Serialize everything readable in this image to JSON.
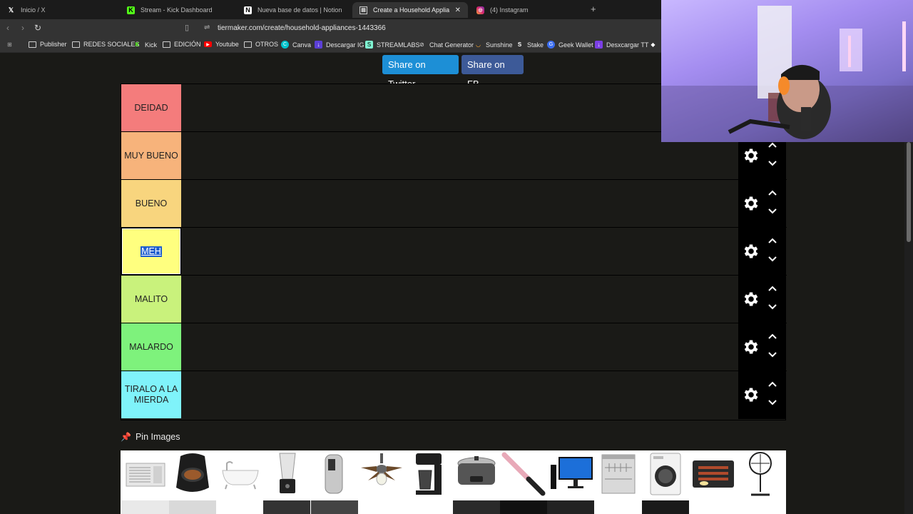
{
  "browser": {
    "tabs": [
      {
        "title": "Inicio / X",
        "icon": "x-logo-icon",
        "active": false
      },
      {
        "title": "Stream - Kick Dashboard",
        "icon": "kick-logo-icon",
        "active": false
      },
      {
        "title": "Nueva base de datos | Notion",
        "icon": "notion-logo-icon",
        "active": false
      },
      {
        "title": "Create a Household Appliances",
        "icon": "tiermaker-icon",
        "active": true
      },
      {
        "title": "(4) Instagram",
        "icon": "instagram-logo-icon",
        "active": false
      }
    ],
    "new_tab": "+",
    "url": "tiermaker.com/create/household-appliances-1443366",
    "bookmarks": [
      {
        "label": "Publisher",
        "icon": "folder-icon"
      },
      {
        "label": "REDES SOCIALES",
        "icon": "folder-icon"
      },
      {
        "label": "Kick",
        "icon": "kick-logo-icon"
      },
      {
        "label": "EDICIÓN",
        "icon": "folder-icon"
      },
      {
        "label": "Youtube",
        "icon": "youtube-logo-icon"
      },
      {
        "label": "OTROS",
        "icon": "folder-icon"
      },
      {
        "label": "Canva",
        "icon": "canva-logo-icon"
      },
      {
        "label": "Descargar IG",
        "icon": "download-icon"
      },
      {
        "label": "STREAMLABS",
        "icon": "streamlabs-logo-icon"
      },
      {
        "label": "Chat Generator",
        "icon": "chat-icon"
      },
      {
        "label": "Sunshine",
        "icon": "sunshine-icon"
      },
      {
        "label": "Stake",
        "icon": "stake-logo-icon"
      },
      {
        "label": "Geek Wallet",
        "icon": "wallet-icon"
      },
      {
        "label": "Desxcargar TT",
        "icon": "tiktok-icon"
      }
    ]
  },
  "share": {
    "twitter": "Share on Twitter",
    "facebook": "Share on FB"
  },
  "tiers": [
    {
      "label": "DEIDAD",
      "color": "#f47c7c"
    },
    {
      "label": "MUY BUENO",
      "color": "#f7b37b"
    },
    {
      "label": "BUENO",
      "color": "#f8d57e"
    },
    {
      "label": "MEH",
      "color": "#ffff7f",
      "editing": true
    },
    {
      "label": "MALITO",
      "color": "#c9f27c"
    },
    {
      "label": "MALARDO",
      "color": "#7ef27c"
    },
    {
      "label": "TIRALO A LA MIERDA",
      "color": "#7ff3fa"
    }
  ],
  "pin_images": {
    "title": "Pin Images",
    "icon": "pushpin-icon",
    "items": [
      "air-conditioner-image",
      "air-fryer-image",
      "bathtub-image",
      "blender-image",
      "can-opener-image",
      "ceiling-fan-image",
      "coffee-maker-image",
      "slow-cooker-image",
      "curling-iron-image",
      "desktop-computer-image",
      "dishwasher-image",
      "washing-machine-image",
      "griddle-image",
      "standing-fan-image"
    ]
  },
  "colors": {
    "twitter_blue": "#1d8fd6",
    "facebook_blue": "#3d5a98",
    "page_bg": "#1a1a17",
    "selection_blue": "#1e5fcf"
  }
}
